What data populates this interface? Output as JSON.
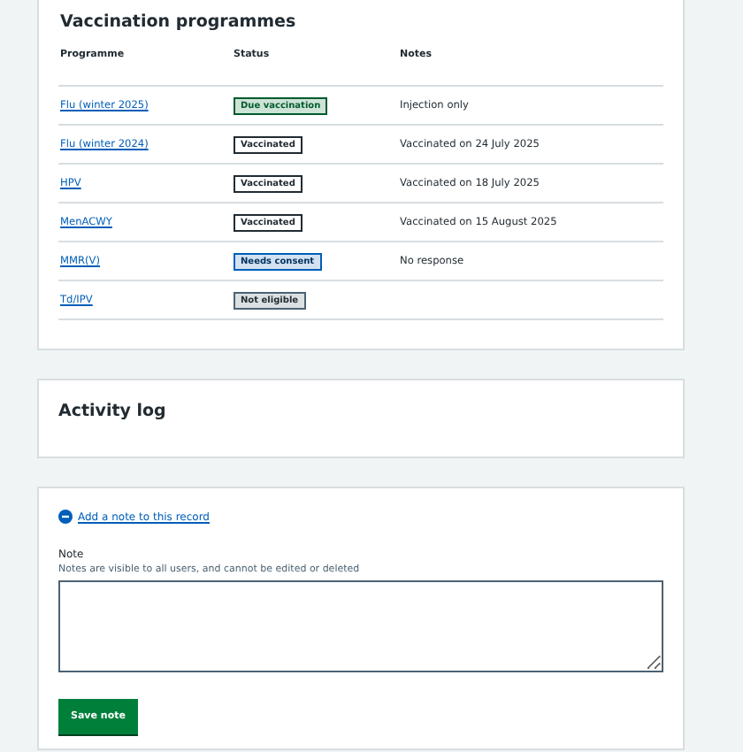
{
  "vaccination_programmes": {
    "title": "Vaccination programmes",
    "columns": [
      "Programme",
      "Status",
      "Notes"
    ],
    "rows": [
      {
        "programme": "Flu (winter 2025)",
        "status": {
          "label": "Due vaccination",
          "kind": "due"
        },
        "notes": "Injection only"
      },
      {
        "programme": "Flu (winter 2024)",
        "status": {
          "label": "Vaccinated",
          "kind": "vaccinated"
        },
        "notes": "Vaccinated on 24 July 2025"
      },
      {
        "programme": "HPV",
        "status": {
          "label": "Vaccinated",
          "kind": "vaccinated"
        },
        "notes": "Vaccinated on 18 July 2025"
      },
      {
        "programme": "MenACWY",
        "status": {
          "label": "Vaccinated",
          "kind": "vaccinated"
        },
        "notes": "Vaccinated on 15 August 2025"
      },
      {
        "programme": "MMR(V)",
        "status": {
          "label": "Needs consent",
          "kind": "consent"
        },
        "notes": "No response"
      },
      {
        "programme": "Td/IPV",
        "status": {
          "label": "Not eligible",
          "kind": "ineligible"
        }
      }
    ]
  },
  "activity_log": {
    "title": "Activity log"
  },
  "note_form": {
    "toggle": {
      "label": "Add a note to this record",
      "expanded": true
    },
    "label": "Note",
    "hint": "Notes are visible to all users, and cannot be edited or deleted",
    "button": "Save note"
  }
}
